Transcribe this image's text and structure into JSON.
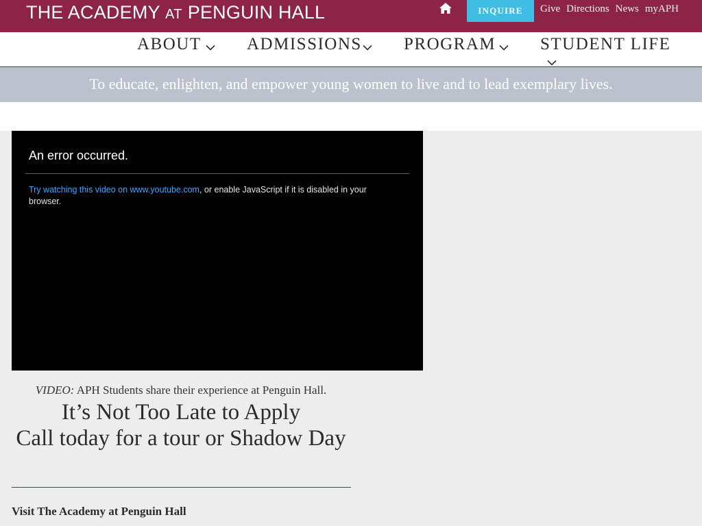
{
  "header": {
    "logo_main": "THE ACADEMY",
    "logo_at": "AT",
    "logo_end": "PENGUIN HALL",
    "home_icon": "home-icon",
    "inquire_label": "INQUIRE",
    "links": [
      "Give",
      "Directions",
      "News",
      "myAPH"
    ],
    "brand_color": "#8d2347",
    "accent_color": "#3fbde2"
  },
  "nav": {
    "items": [
      {
        "label": "ABOUT",
        "icon": "chevron-down-icon"
      },
      {
        "label": "ADMISSIONS",
        "icon": "chevron-down-icon"
      },
      {
        "label": "PROGRAM",
        "icon": "chevron-down-icon"
      },
      {
        "label": "STUDENT LIFE",
        "icon": "chevron-down-icon"
      }
    ]
  },
  "mission": {
    "text": "To educate, enlighten, and empower young women to live and to lead exemplary lives."
  },
  "video": {
    "error_title": "An error occurred.",
    "error_link": "Try watching this video on www.youtube.com",
    "error_rest": ", or enable JavaScript if it is disabled in your browser."
  },
  "content": {
    "caption_label": "VIDEO:",
    "caption_text": " APH Students share their experience at Penguin Hall.",
    "cta_line1": "It’s Not Too Late to Apply",
    "cta_line2": "Call today for a tour or Shadow Day",
    "visit_heading": "Visit The Academy at Penguin Hall"
  }
}
